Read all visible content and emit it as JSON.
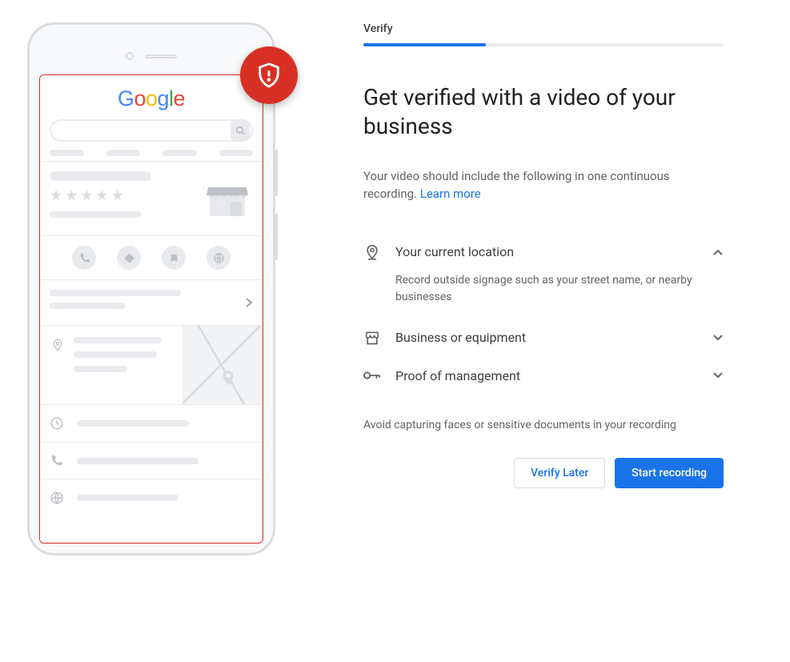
{
  "illustration": {
    "logo_letters": [
      "G",
      "o",
      "o",
      "g",
      "l",
      "e"
    ],
    "badge_icon": "shield-alert-icon"
  },
  "step": {
    "label": "Verify",
    "progress_pct": 34
  },
  "heading": "Get verified with a video of your business",
  "subtext": {
    "body": "Your video should include the following in one continuous recording. ",
    "link": "Learn more"
  },
  "accordion": {
    "items": [
      {
        "icon": "location-pin-icon",
        "title": "Your current location",
        "body": "Record outside signage such as your street name, or nearby businesses",
        "expanded": true
      },
      {
        "icon": "storefront-icon",
        "title": "Business or equipment",
        "body": "",
        "expanded": false
      },
      {
        "icon": "key-icon",
        "title": "Proof of management",
        "body": "",
        "expanded": false
      }
    ]
  },
  "warning": "Avoid capturing faces or sensitive documents in your recording",
  "buttons": {
    "secondary": "Verify Later",
    "primary": "Start recording"
  },
  "colors": {
    "accent": "#1a73e8",
    "danger": "#d93025",
    "text_primary": "#202124",
    "text_secondary": "#5f6368",
    "border": "#dadce0"
  }
}
